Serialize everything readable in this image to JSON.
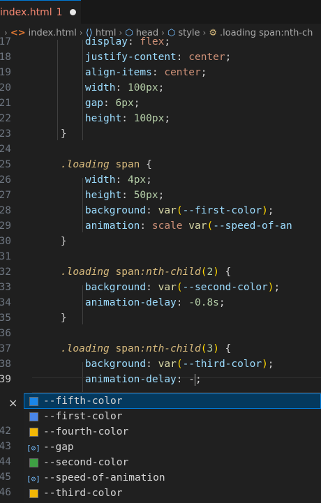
{
  "tab": {
    "filename": "index.html",
    "problems": "1"
  },
  "breadcrumb": [
    {
      "icon": "html-file-icon",
      "label": "index.html"
    },
    {
      "icon": "html-tag-icon",
      "label": "html"
    },
    {
      "icon": "cube-icon",
      "label": "head"
    },
    {
      "icon": "cube-icon",
      "label": "style"
    },
    {
      "icon": "css-rule-icon",
      "label": ".loading span:nth-ch"
    }
  ],
  "code_lines": [
    {
      "n": "17",
      "text": "        display: flex;"
    },
    {
      "n": "18",
      "text": "        justify-content: center;"
    },
    {
      "n": "19",
      "text": "        align-items: center;"
    },
    {
      "n": "20",
      "text": "        width: 100px;"
    },
    {
      "n": "21",
      "text": "        gap: 6px;"
    },
    {
      "n": "22",
      "text": "        height: 100px;"
    },
    {
      "n": "23",
      "text": "    }"
    },
    {
      "n": "24",
      "text": ""
    },
    {
      "n": "25",
      "text": "    .loading span {"
    },
    {
      "n": "26",
      "text": "        width: 4px;"
    },
    {
      "n": "27",
      "text": "        height: 50px;"
    },
    {
      "n": "28",
      "text": "        background: var(--first-color);"
    },
    {
      "n": "29",
      "text": "        animation: scale var(--speed-of-an"
    },
    {
      "n": "30",
      "text": "    }"
    },
    {
      "n": "31",
      "text": ""
    },
    {
      "n": "32",
      "text": "    .loading span:nth-child(2) {"
    },
    {
      "n": "33",
      "text": "        background: var(--second-color);"
    },
    {
      "n": "34",
      "text": "        animation-delay: -0.8s;"
    },
    {
      "n": "35",
      "text": "    }"
    },
    {
      "n": "36",
      "text": ""
    },
    {
      "n": "37",
      "text": "    .loading span:nth-child(3) {"
    },
    {
      "n": "38",
      "text": "        background: var(--third-color);"
    },
    {
      "n": "39",
      "text": "        animation-delay: -"
    }
  ],
  "lower_line_numbers": [
    "42",
    "43",
    "44",
    "45",
    "46"
  ],
  "suggestions": [
    {
      "label": "--fifth-color",
      "kind": "color",
      "color": "#1a86e8",
      "active": true
    },
    {
      "label": "--first-color",
      "kind": "color",
      "color": "#4a86e8",
      "active": false
    },
    {
      "label": "--fourth-color",
      "kind": "color",
      "color": "#f2b705",
      "active": false
    },
    {
      "label": "--gap",
      "kind": "variable",
      "color": "",
      "active": false
    },
    {
      "label": "--second-color",
      "kind": "color",
      "color": "#3ea043",
      "active": false
    },
    {
      "label": "--speed-of-animation",
      "kind": "variable",
      "color": "",
      "active": false
    },
    {
      "label": "--third-color",
      "kind": "color",
      "color": "#f2b705",
      "active": false
    }
  ],
  "close_label": "×"
}
